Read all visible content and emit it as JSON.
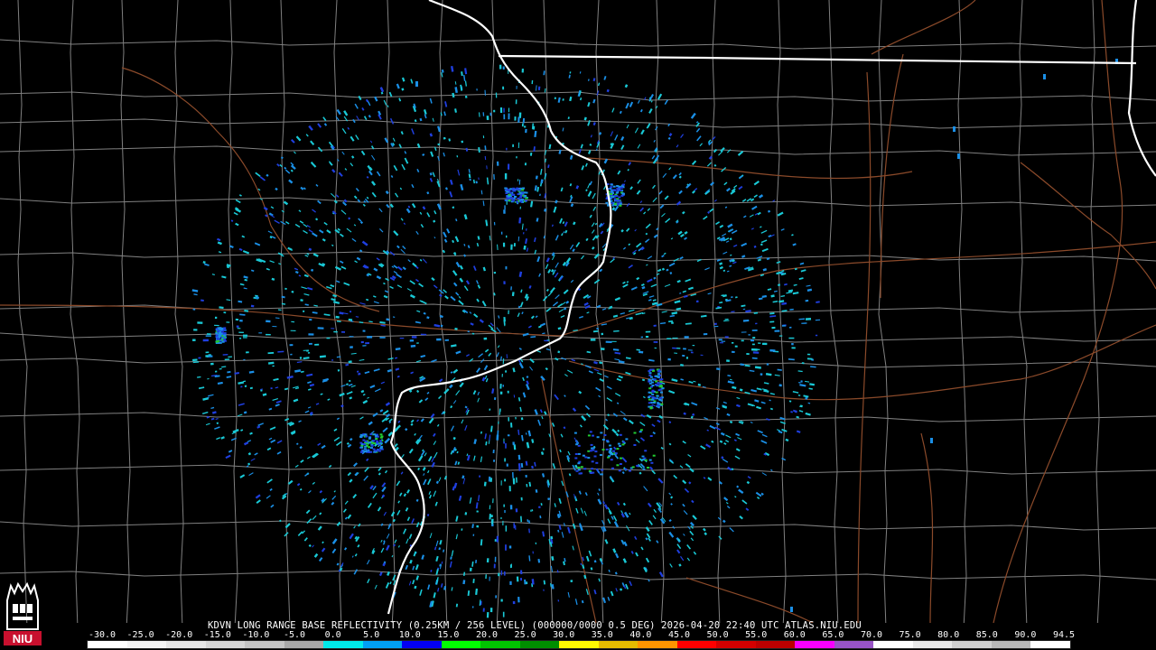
{
  "product": {
    "title": "KDVN LONG RANGE BASE REFLECTIVITY (0.25KM / 256 LEVEL) (000000/0000 0.5 DEG) 2026-04-20 22:40 UTC  ATLAS.NIU.EDU"
  },
  "scale": {
    "labels": [
      "-30.0",
      "-25.0",
      "-20.0",
      "-15.0",
      "-10.0",
      "-5.0",
      "0.0",
      "5.0",
      "10.0",
      "15.0",
      "20.0",
      "25.0",
      "30.0",
      "35.0",
      "40.0",
      "45.0",
      "50.0",
      "55.0",
      "60.0",
      "65.0",
      "70.0",
      "75.0",
      "80.0",
      "85.0",
      "90.0",
      "94.5"
    ],
    "colors": [
      "#ffffff",
      "#f4f4f4",
      "#e6e6e6",
      "#d6d6d6",
      "#c4c4c4",
      "#a8a8a8",
      "#00eaea",
      "#019ff4",
      "#0300f4",
      "#02fd02",
      "#01c501",
      "#008e00",
      "#fdf802",
      "#e5bc00",
      "#fd9500",
      "#fd0000",
      "#d40000",
      "#bc0000",
      "#f800fd",
      "#9854c6",
      "#fdfdfd",
      "#e8e8e8",
      "#d0d0d0",
      "#b8b8b8",
      "#ffffff"
    ]
  },
  "logo": {
    "text": "NIU",
    "colors": {
      "red": "#c8102e",
      "white": "#ffffff"
    }
  },
  "map": {
    "colors": {
      "county": "#808080",
      "state": "#ffffff",
      "highway": "#8b4a2a",
      "echo_light": "#19c9d6",
      "echo_mid": "#1a8fe6",
      "echo_deep": "#1f3fe0",
      "echo_green": "#22cc33"
    }
  }
}
